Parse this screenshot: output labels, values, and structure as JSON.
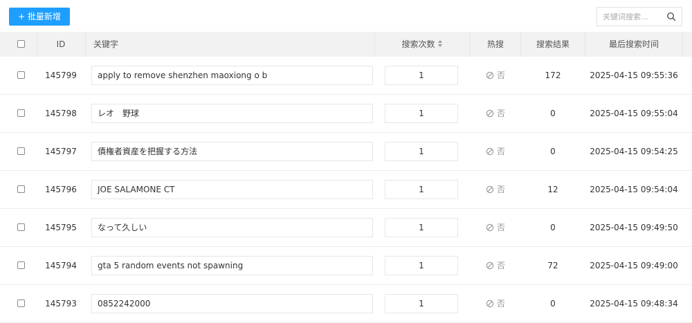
{
  "toolbar": {
    "add_button": "+ 批量新增",
    "search_placeholder": "关键词搜索..."
  },
  "table": {
    "headers": {
      "id": "ID",
      "keyword": "关键字",
      "count": "搜索次数",
      "hot": "热搜",
      "results": "搜索结果",
      "last_time": "最后搜索时间"
    },
    "rows": [
      {
        "id": "145799",
        "keyword": "apply to remove shenzhen maoxiong o b",
        "count": "1",
        "hot": "否",
        "results": "172",
        "time": "2025-04-15 09:55:36"
      },
      {
        "id": "145798",
        "keyword": "レオ　野球",
        "count": "1",
        "hot": "否",
        "results": "0",
        "time": "2025-04-15 09:55:04"
      },
      {
        "id": "145797",
        "keyword": "債権者資産を把握する方法",
        "count": "1",
        "hot": "否",
        "results": "0",
        "time": "2025-04-15 09:54:25"
      },
      {
        "id": "145796",
        "keyword": "JOE SALAMONE CT",
        "count": "1",
        "hot": "否",
        "results": "12",
        "time": "2025-04-15 09:54:04"
      },
      {
        "id": "145795",
        "keyword": "なって久しい",
        "count": "1",
        "hot": "否",
        "results": "0",
        "time": "2025-04-15 09:49:50"
      },
      {
        "id": "145794",
        "keyword": "gta 5 random events not spawning",
        "count": "1",
        "hot": "否",
        "results": "72",
        "time": "2025-04-15 09:49:00"
      },
      {
        "id": "145793",
        "keyword": "0852242000",
        "count": "1",
        "hot": "否",
        "results": "0",
        "time": "2025-04-15 09:48:34"
      }
    ]
  },
  "colors": {
    "accent": "#1E9FFF",
    "header_bg": "#f2f2f2",
    "muted_text": "#999999"
  },
  "icons": {
    "search": "search-icon",
    "sort": "sort-icon",
    "hot_off": "ban-icon"
  }
}
